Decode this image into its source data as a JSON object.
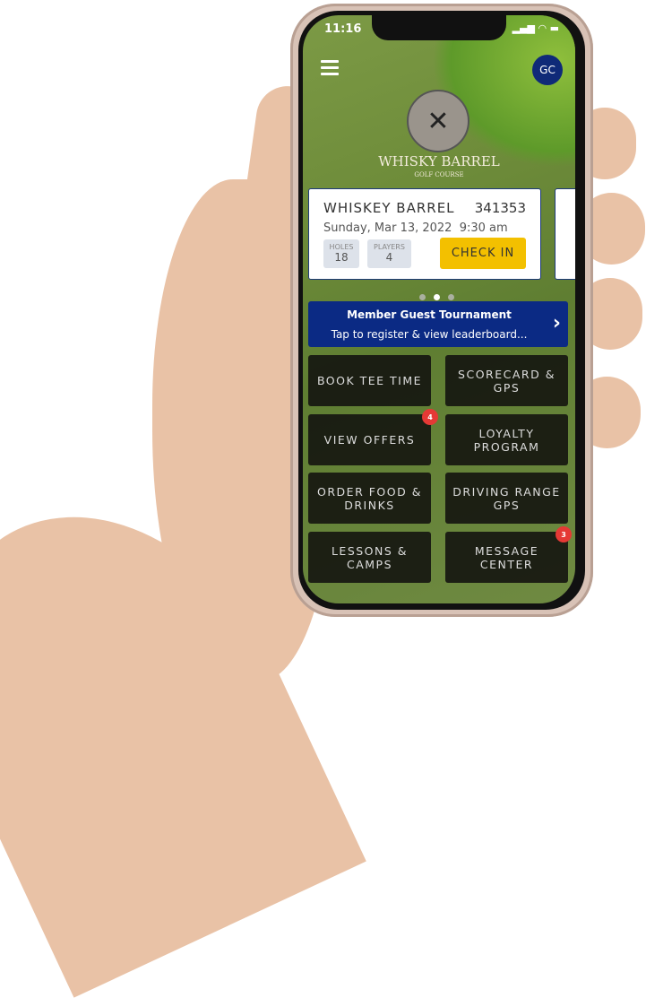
{
  "status": {
    "time": "11:16",
    "icons": "▂▄▆ ◠ ▬"
  },
  "header": {
    "menu_icon": "hamburger-icon",
    "avatar_initials": "GC",
    "logo_title": "WHISKY BARREL",
    "logo_subtitle": "GOLF COURSE",
    "logo_mark": "W✕B"
  },
  "tee_time": {
    "course": "WHISKEY BARREL",
    "confirmation": "341353",
    "date": "Sunday, Mar 13, 2022",
    "time": "9:30 am",
    "holes_label": "HOLES",
    "holes": "18",
    "players_label": "PLAYERS",
    "players": "4",
    "checkin_label": "CHECK IN"
  },
  "carousel": {
    "pages": 3,
    "active": 2
  },
  "banner": {
    "title": "Member Guest Tournament",
    "subtitle": "Tap to register & view leaderboard..."
  },
  "tiles": [
    {
      "label": "BOOK TEE TIME"
    },
    {
      "label": "SCORECARD & GPS"
    },
    {
      "label": "VIEW OFFERS",
      "badge": "4"
    },
    {
      "label": "LOYALTY PROGRAM"
    },
    {
      "label": "ORDER FOOD & DRINKS"
    },
    {
      "label": "DRIVING RANGE GPS"
    },
    {
      "label": "LESSONS & CAMPS"
    },
    {
      "label": "MESSAGE CENTER",
      "badge": "3"
    }
  ],
  "colors": {
    "brand": "#0b2a84",
    "checkin": "#f3c000",
    "badge": "#e53935"
  }
}
